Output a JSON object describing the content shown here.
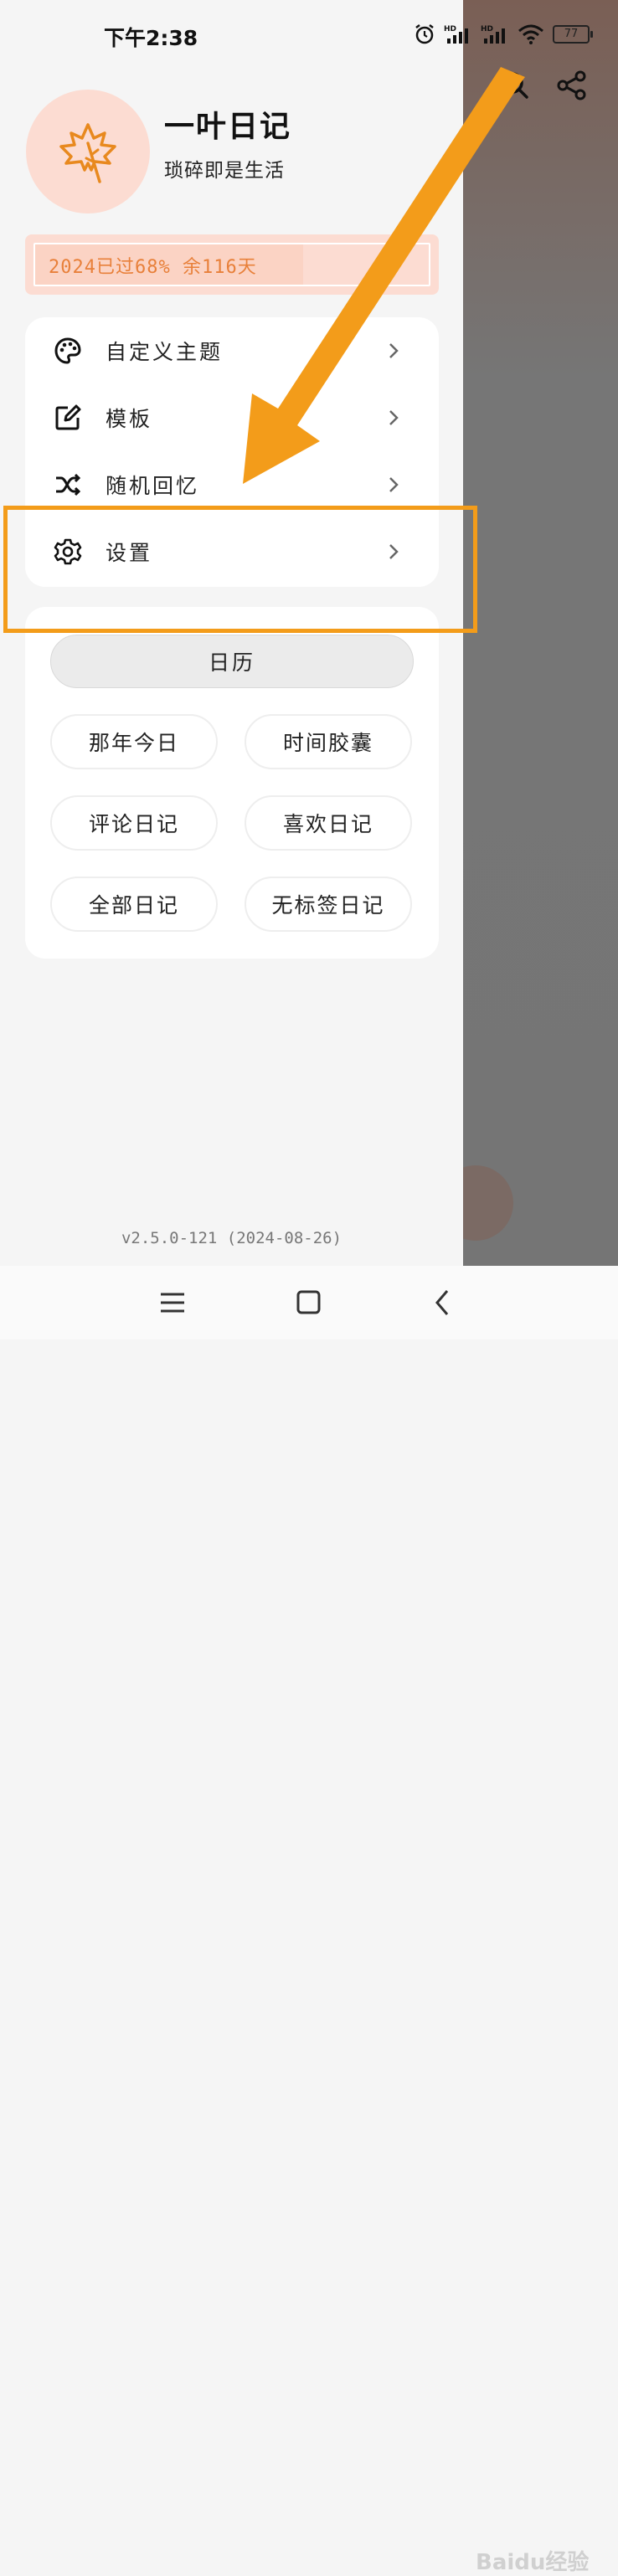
{
  "status_bar": {
    "time": "下午2:38",
    "battery": "77",
    "signal1": "HD",
    "signal2": "HD"
  },
  "header": {
    "app_name": "一叶日记",
    "tagline": "琐碎即是生活"
  },
  "year_progress": {
    "text": "2024已过68% 余116天",
    "percent": 68
  },
  "menu": [
    {
      "label": "自定义主题",
      "icon": "palette-icon"
    },
    {
      "label": "模板",
      "icon": "edit-icon"
    },
    {
      "label": "随机回忆",
      "icon": "shuffle-icon"
    },
    {
      "label": "设置",
      "icon": "gear-icon"
    }
  ],
  "shortcuts": {
    "calendar": "日历",
    "items": [
      "那年今日",
      "时间胶囊",
      "评论日记",
      "喜欢日记",
      "全部日记",
      "无标签日记"
    ]
  },
  "version": "v2.5.0-121 (2024-08-26)",
  "watermark": "Baidu经验",
  "colors": {
    "accent": "#e8803a",
    "annotation": "#f39c1a",
    "avatar_bg": "#fcdcd2"
  }
}
